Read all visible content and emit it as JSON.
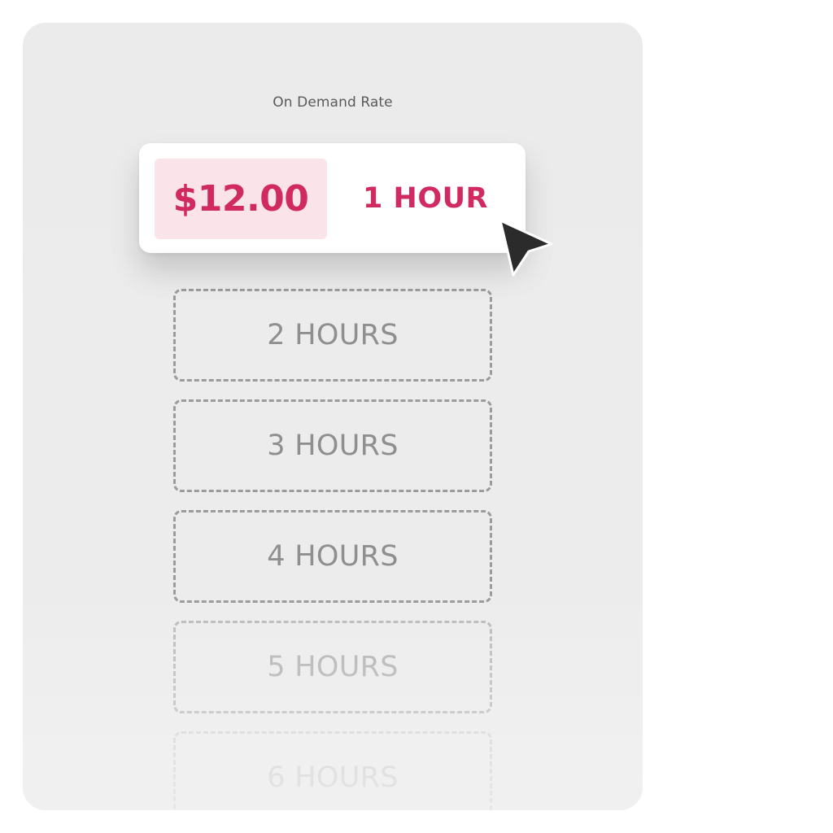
{
  "panel": {
    "title": "On Demand Rate"
  },
  "selected_rate": {
    "price": "$12.00",
    "duration": "1 HOUR"
  },
  "options": [
    {
      "label": "2 HOURS"
    },
    {
      "label": "3 HOURS"
    },
    {
      "label": "4 HOURS"
    },
    {
      "label": "5 HOURS"
    },
    {
      "label": "6 HOURS"
    }
  ],
  "colors": {
    "accent": "#d02a60",
    "accent_bg": "#fbe3ea",
    "panel_bg": "#ebebeb",
    "option_text": "#8f8f8f"
  },
  "icons": {
    "cursor": "mouse-pointer-icon"
  }
}
